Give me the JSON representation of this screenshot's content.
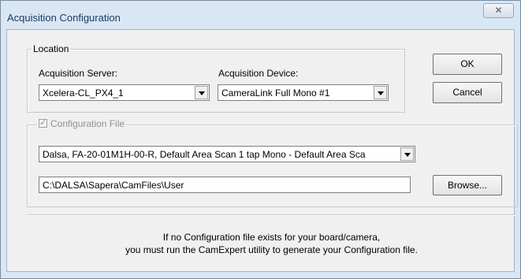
{
  "window": {
    "title": "Acquisition Configuration",
    "close_glyph": "✕"
  },
  "location": {
    "legend": "Location",
    "server_label": "Acquisition Server:",
    "server_value": "Xcelera-CL_PX4_1",
    "device_label": "Acquisition Device:",
    "device_value": "CameraLink Full Mono #1"
  },
  "buttons": {
    "ok": "OK",
    "cancel": "Cancel",
    "browse": "Browse..."
  },
  "config": {
    "legend": "Configuration File",
    "checked": true,
    "file_value": "Dalsa, FA-20-01M1H-00-R, Default Area Scan 1 tap Mono - Default Area Sca",
    "path_value": "C:\\DALSA\\Sapera\\CamFiles\\User"
  },
  "info": {
    "line1": "If no Configuration file exists for your board/camera,",
    "line2": "you must run the CamExpert utility to generate your Configuration file."
  }
}
